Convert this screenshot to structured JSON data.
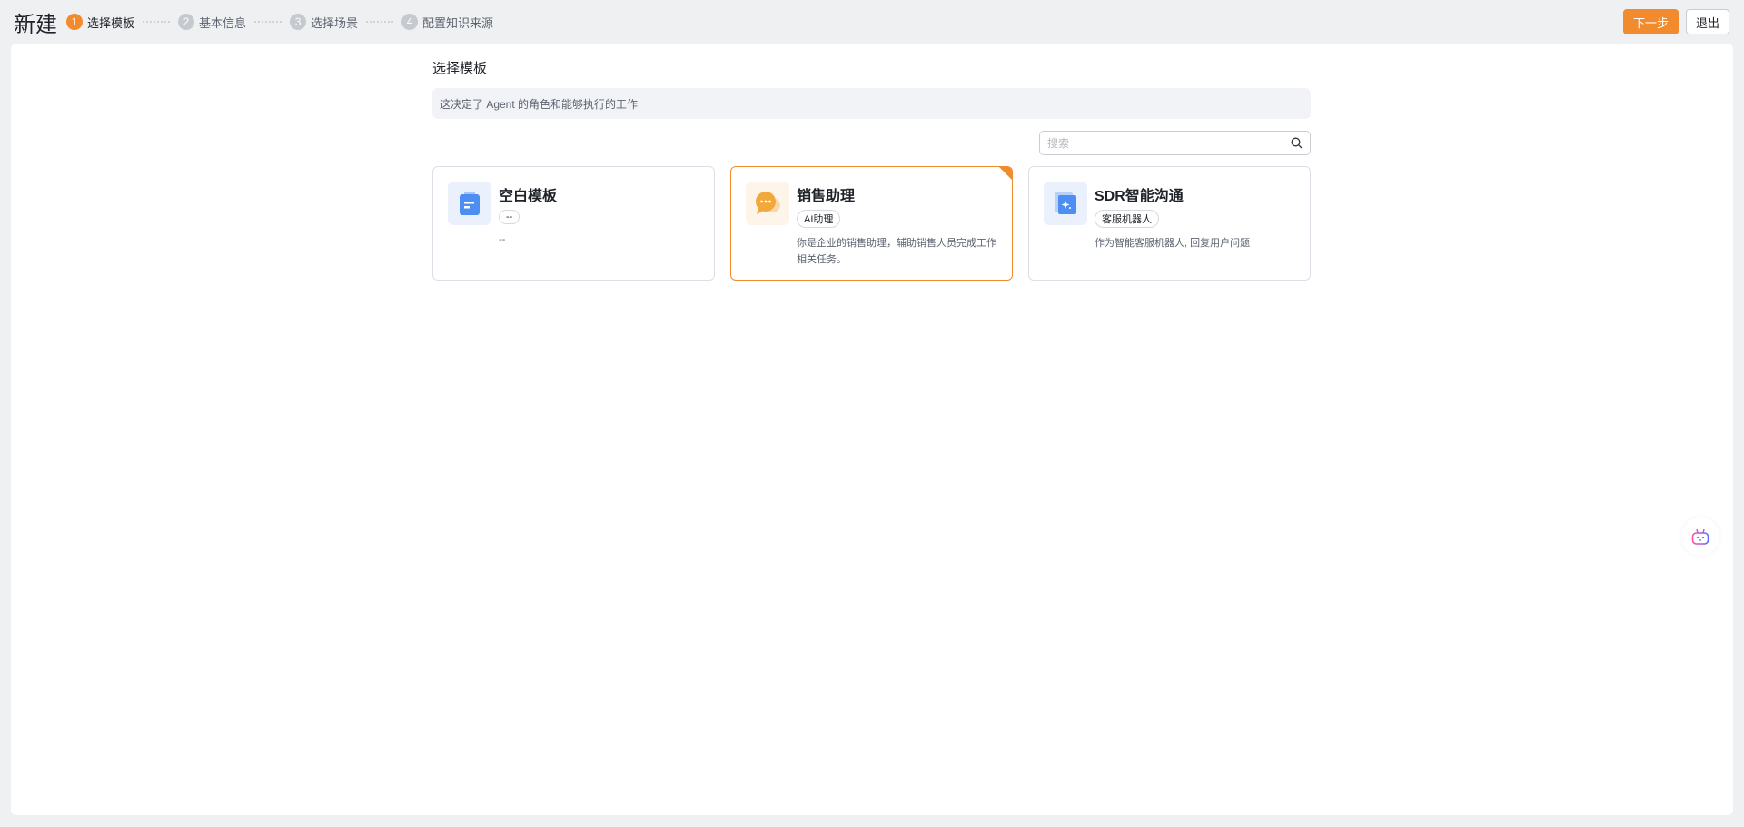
{
  "header": {
    "title": "新建",
    "next_label": "下一步",
    "exit_label": "退出",
    "steps": [
      {
        "num": "1",
        "label": "选择模板"
      },
      {
        "num": "2",
        "label": "基本信息"
      },
      {
        "num": "3",
        "label": "选择场景"
      },
      {
        "num": "4",
        "label": "配置知识来源"
      }
    ]
  },
  "main": {
    "section_title": "选择模板",
    "info": "这决定了 Agent 的角色和能够执行的工作",
    "search_placeholder": "搜索",
    "cards": [
      {
        "name": "空白模板",
        "tag": "--",
        "desc": "--"
      },
      {
        "name": "销售助理",
        "tag": "AI助理",
        "desc": "你是企业的销售助理，辅助销售人员完成工作相关任务。"
      },
      {
        "name": "SDR智能沟通",
        "tag": "客服机器人",
        "desc": "作为智能客服机器人, 回复用户问题"
      }
    ]
  },
  "colors": {
    "accent": "#f28a2e"
  }
}
